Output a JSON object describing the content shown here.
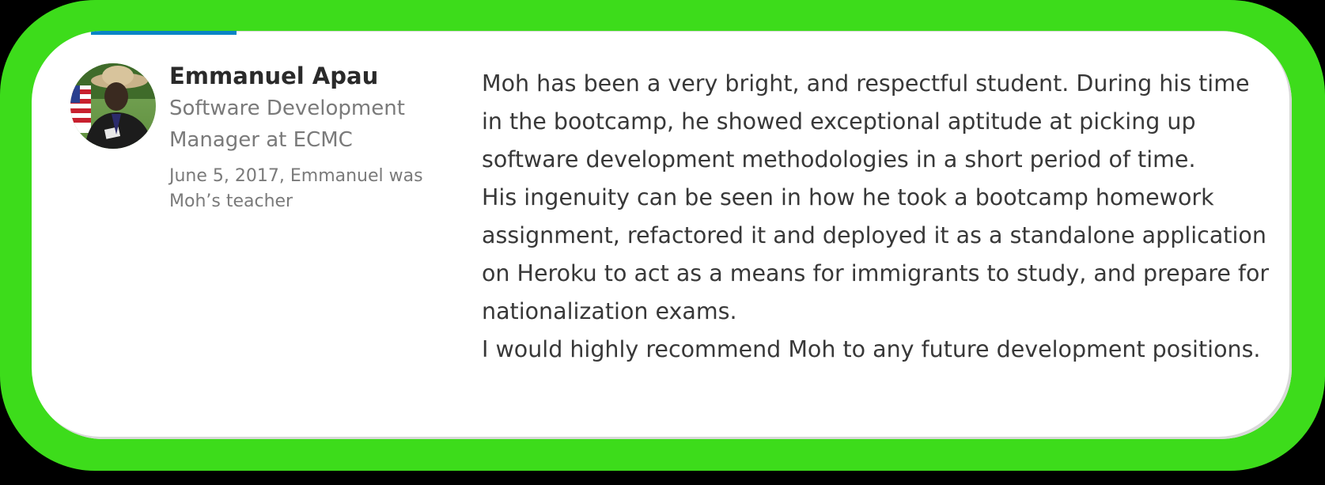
{
  "recommender": {
    "name": "Emmanuel Apau",
    "headline": "Software Development Manager at ECMC",
    "meta": "June 5, 2017, Emmanuel was Moh’s teacher",
    "avatar_icon": "person-photo-avatar"
  },
  "recommendation": {
    "paragraph_1": "Moh has been a very bright, and respectful student. During his time in the bootcamp, he showed exceptional aptitude at picking up software development methodologies in a short period of time.",
    "paragraph_2": "His ingenuity can be seen in how he took a bootcamp homework assignment, refactored it and deployed it as a standalone application on Heroku to act as a means for immigrants to study, and prepare for nationalization exams.",
    "paragraph_3": "I would highly recommend Moh to any future development positions."
  },
  "colors": {
    "frame_green": "#3ddc1b",
    "active_tab_blue": "#0a84c6",
    "card_background": "#ffffff",
    "name_text": "#2a2a2a",
    "secondary_text": "#7a7a7a",
    "body_text": "#383838"
  }
}
